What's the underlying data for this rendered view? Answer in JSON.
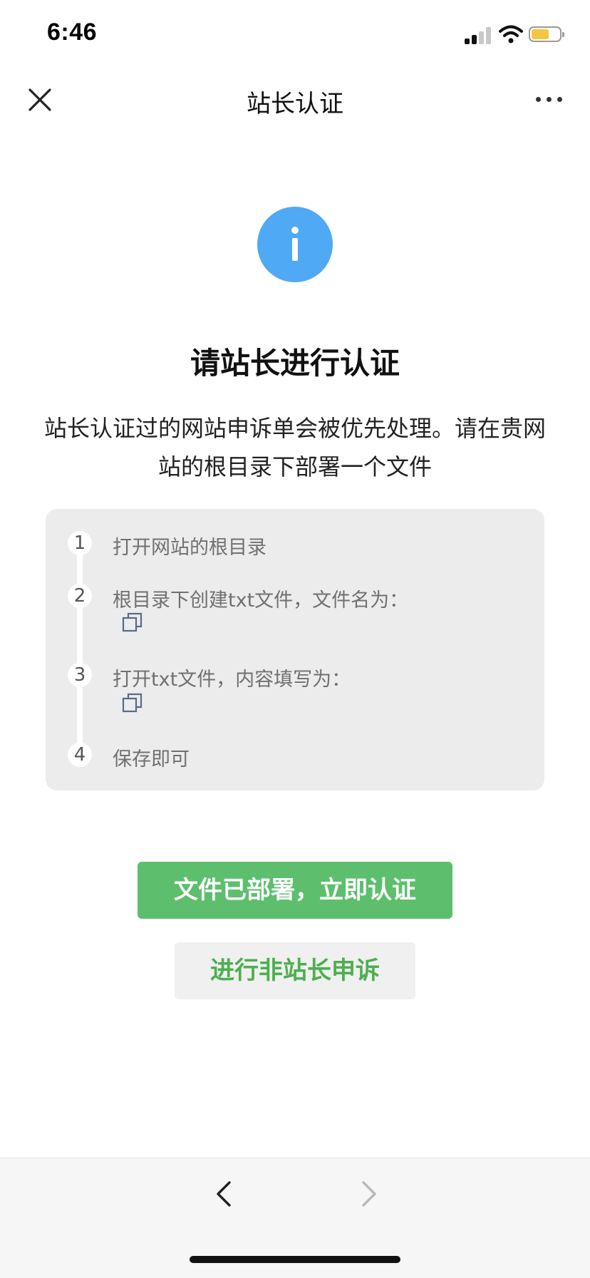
{
  "status_bar": {
    "time": "6:46",
    "battery_color": "#f5c542"
  },
  "nav": {
    "title": "站长认证",
    "close_icon": "close-icon",
    "more_icon": "more-icon"
  },
  "main": {
    "info_icon": "info-icon",
    "info_color": "#4fa9f5",
    "title": "请站长进行认证",
    "description": "站长认证过的网站申诉单会被优先处理。请在贵网站的根目录下部署一个文件"
  },
  "steps": [
    {
      "number": "1",
      "text": "打开网站的根目录",
      "has_copy": false
    },
    {
      "number": "2",
      "text": "根目录下创建txt文件，文件名为：",
      "has_copy": true
    },
    {
      "number": "3",
      "text": "打开txt文件，内容填写为：",
      "has_copy": true
    },
    {
      "number": "4",
      "text": "保存即可",
      "has_copy": false
    }
  ],
  "buttons": {
    "primary_label": "文件已部署，立即认证",
    "primary_color": "#5dbf6e",
    "secondary_label": "进行非站长申诉",
    "secondary_text_color": "#4caf50"
  },
  "toolbar": {
    "back_icon": "chevron-left-icon",
    "forward_icon": "chevron-right-icon"
  }
}
